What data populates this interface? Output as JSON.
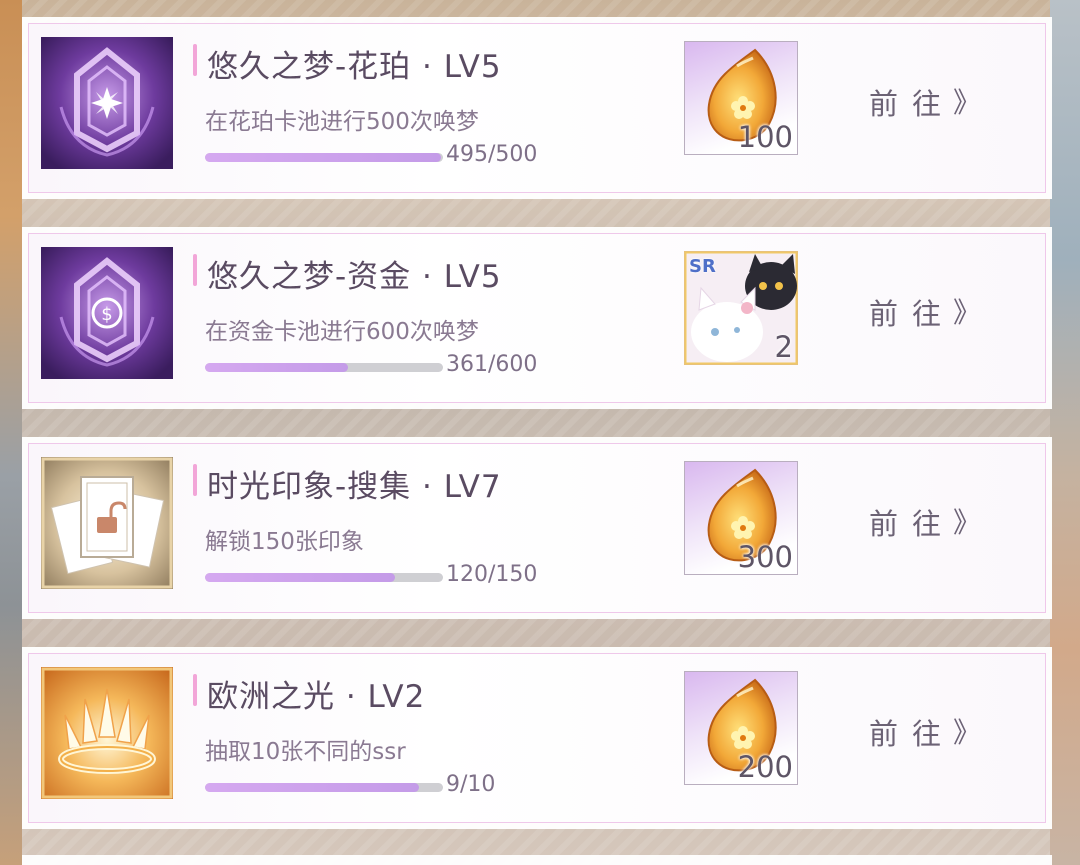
{
  "tasks": [
    {
      "title": "悠久之梦-花珀 · LV5",
      "description": "在花珀卡池进行500次唤梦",
      "current": 495,
      "target": 500,
      "progress_text": "495/500",
      "progress": 0.99,
      "badge_icon": "amber-star-crest-icon",
      "reward_icon": "amber-drop-icon",
      "reward_qty": "100",
      "goto_label": "前往",
      "goto_arrow": "》"
    },
    {
      "title": "悠久之梦-资金 · LV5",
      "description": "在资金卡池进行600次唤梦",
      "current": 361,
      "target": 600,
      "progress_text": "361/600",
      "progress": 0.6017,
      "badge_icon": "coin-crest-icon",
      "reward_icon": "sr-cat-card-icon",
      "reward_badge": "SR",
      "reward_qty": "2",
      "goto_label": "前往",
      "goto_arrow": "》"
    },
    {
      "title": "时光印象-搜集 · LV7",
      "description": "解锁150张印象",
      "current": 120,
      "target": 150,
      "progress_text": "120/150",
      "progress": 0.8,
      "badge_icon": "unlocked-cards-icon",
      "reward_icon": "amber-drop-icon",
      "reward_qty": "300",
      "goto_label": "前往",
      "goto_arrow": "》"
    },
    {
      "title": "欧洲之光 · LV2",
      "description": "抽取10张不同的ssr",
      "current": 9,
      "target": 10,
      "progress_text": "9/10",
      "progress": 0.9,
      "badge_icon": "golden-crown-icon",
      "reward_icon": "amber-drop-icon",
      "reward_qty": "200",
      "goto_label": "前往",
      "goto_arrow": "》"
    }
  ],
  "colors": {
    "progress_fill": "#c9a2ec",
    "progress_track": "#cfcfd3",
    "accent_bar": "#f2a6d8",
    "card_border": "#efc8ea"
  }
}
